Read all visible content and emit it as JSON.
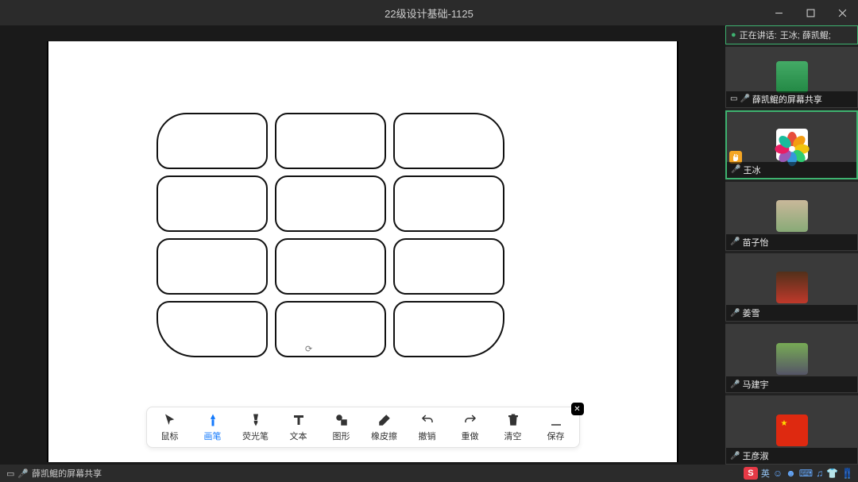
{
  "window": {
    "title": "22级设计基础-1125"
  },
  "speaking": {
    "prefix": "正在讲话:",
    "names": "王冰; 薛凯鲲;"
  },
  "participants": [
    {
      "name": "薛凯鲲的屏幕共享",
      "share": true,
      "mic": "muted",
      "avatarType": "green-doll"
    },
    {
      "name": "王冰",
      "mic": "on",
      "raise": true,
      "active": true,
      "avatarType": "flower"
    },
    {
      "name": "苗子怡",
      "mic": "muted",
      "avatarType": "photo1"
    },
    {
      "name": "姜雪",
      "mic": "muted",
      "avatarType": "photo2"
    },
    {
      "name": "马建宇",
      "mic": "muted",
      "avatarType": "photo3"
    },
    {
      "name": "王彦淑",
      "mic": "muted",
      "avatarType": "flag"
    }
  ],
  "toolbar": {
    "tools": [
      {
        "label": "鼠标",
        "icon": "cursor"
      },
      {
        "label": "画笔",
        "icon": "pen",
        "active": true
      },
      {
        "label": "荧光笔",
        "icon": "highlighter"
      },
      {
        "label": "文本",
        "icon": "text"
      },
      {
        "label": "图形",
        "icon": "shapes"
      },
      {
        "label": "橡皮擦",
        "icon": "eraser"
      },
      {
        "label": "撤销",
        "icon": "undo"
      },
      {
        "label": "重做",
        "icon": "redo"
      },
      {
        "label": "清空",
        "icon": "trash"
      },
      {
        "label": "保存",
        "icon": "save"
      }
    ]
  },
  "bottombar": {
    "label": "薛凯鲲的屏幕共享"
  },
  "ime": {
    "badge": "S",
    "lang": "英"
  }
}
